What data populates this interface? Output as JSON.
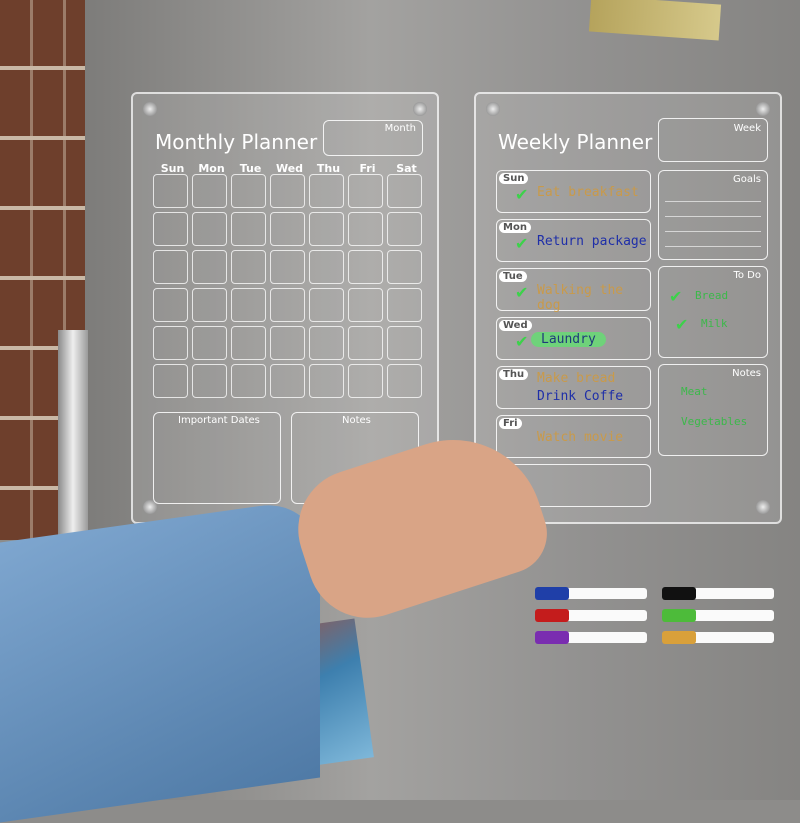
{
  "monthly": {
    "title": "Monthly Planner",
    "month_label": "Month",
    "days": [
      "Sun",
      "Mon",
      "Tue",
      "Wed",
      "Thu",
      "Fri",
      "Sat"
    ],
    "important_dates": "Important Dates",
    "notes": "Notes"
  },
  "weekly": {
    "title": "Weekly Planner",
    "week_label": "Week",
    "goals": "Goals",
    "todo": "To Do",
    "notes": "Notes",
    "days": [
      {
        "day": "Sun",
        "task": "Eat breakfast",
        "color": "#c99a4a"
      },
      {
        "day": "Mon",
        "task": "Return package",
        "color": "#1f2fa8"
      },
      {
        "day": "Tue",
        "task": "Walking the dog",
        "color": "#c99a4a"
      },
      {
        "day": "Wed",
        "task": "Laundry",
        "color": "#1f3a7a"
      },
      {
        "day": "Thu",
        "task": "Make bread",
        "task2": "Drink Coffe",
        "color": "#c99a4a",
        "color2": "#1f2fa8"
      },
      {
        "day": "Fri",
        "task": "Watch movie",
        "color": "#c99a4a"
      }
    ],
    "todo_items": [
      "Bread",
      "Milk"
    ],
    "notes_items": [
      "Meat",
      "Vegetables"
    ]
  },
  "markers": [
    "#1f3fa8",
    "#111111",
    "#c41c1c",
    "#4dbb3a",
    "#7a2db0",
    "#d9a03a"
  ]
}
